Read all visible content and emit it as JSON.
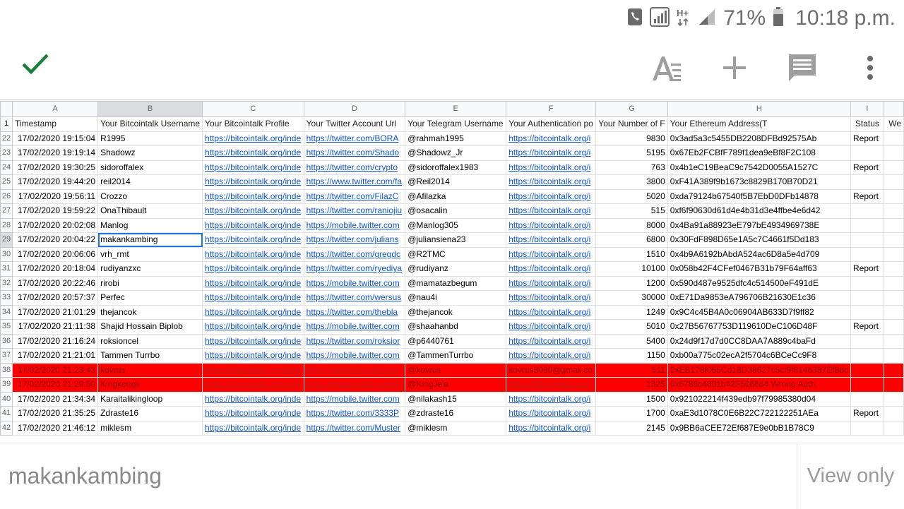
{
  "status_bar": {
    "battery_percent": "71%",
    "time": "10:18 p.m."
  },
  "colors": {
    "accent_check": "#188038",
    "link": "#1155cc",
    "error_row": "#ff0000",
    "selection": "#1a73e8"
  },
  "toolbar": {
    "check_icon": "check-icon",
    "format_icon": "text-format-icon",
    "add_icon": "plus-icon",
    "comment_icon": "comment-icon",
    "more_icon": "more-vertical-icon"
  },
  "columns": [
    "A",
    "B",
    "C",
    "D",
    "E",
    "F",
    "G",
    "H",
    "I"
  ],
  "header_row": {
    "num": "1",
    "cells": [
      "Timestamp",
      "Your Bitcointalk Username",
      "Your Bitcointalk Profile",
      "Your Twitter Account Url",
      "Your Telegram Username",
      "Your Authentication po",
      "Your Number of F",
      "Your Ethereum Address(T",
      "Status",
      "We"
    ]
  },
  "rows": [
    {
      "num": "22",
      "ts": "17/02/2020 19:15:04",
      "user": "R1995",
      "profile": "https://bitcointalk.org/inde",
      "twitter": "https://twitter.com/BORA",
      "tg": "@rahmah1995",
      "auth": "https://bitcointalk.org/i",
      "followers": "9830",
      "eth": "0x3ad5a3c5455DB2208DFBd92575Ab",
      "status": "Report"
    },
    {
      "num": "23",
      "ts": "17/02/2020 19:19:14",
      "user": "Shadowz",
      "profile": "https://bitcointalk.org/inde",
      "twitter": "https://twitter.com/Shado",
      "tg": "@Shadowz_Jr",
      "auth": "https://bitcointalk.org/i",
      "followers": "5195",
      "eth": "0x67Eb2FCBfF789f1dea9eBf8F2C108",
      "status": ""
    },
    {
      "num": "24",
      "ts": "17/02/2020 19:30:25",
      "user": "sidoroffalex",
      "profile": "https://bitcointalk.org/inde",
      "twitter": "https://twitter.com/crypto",
      "tg": "@sidoroffalex1983",
      "auth": "https://bitcointalk.org/i",
      "followers": "763",
      "eth": "0x4b1eC19BeaC9c7542D0055A1527C",
      "status": "Report"
    },
    {
      "num": "25",
      "ts": "17/02/2020 19:44:20",
      "user": "reil2014",
      "profile": "https://bitcointalk.org/inde",
      "twitter": "https://www.twitter.com/fa",
      "tg": "@Reil2014",
      "auth": "https://bitcointalk.org/i",
      "followers": "3800",
      "eth": "0xF41A389f9b1673c8829B170B70D21",
      "status": ""
    },
    {
      "num": "26",
      "ts": "17/02/2020 19:56:11",
      "user": "Crozzo",
      "profile": "https://bitcointalk.org/inde",
      "twitter": "https://twitter.com/FilazC",
      "tg": "@Afilazka",
      "auth": "https://bitcointalk.org/i",
      "followers": "5020",
      "eth": "0xda79124b67540f5B7EbD0DFb14878",
      "status": "Report"
    },
    {
      "num": "27",
      "ts": "17/02/2020 19:59:22",
      "user": "OnaThibault",
      "profile": "https://bitcointalk.org/inde",
      "twitter": "https://twitter.com/raniojiu",
      "tg": "@osacalin",
      "auth": "https://bitcointalk.org/i",
      "followers": "515",
      "eth": "0xf6f90630d61d4e4b31d3e4ffbe4e6d42",
      "status": ""
    },
    {
      "num": "28",
      "ts": "17/02/2020 20:02:08",
      "user": "Manlog",
      "profile": "https://bitcointalk.org/inde",
      "twitter": "https://mobile.twitter.com",
      "tg": "@Manlog305",
      "auth": "https://bitcointalk.org/i",
      "followers": "8000",
      "eth": "0x4Ba91a88923eE797bE4934969738E",
      "status": ""
    },
    {
      "num": "29",
      "ts": "17/02/2020 20:04:22",
      "user": "makankambing",
      "profile": "https://bitcointalk.org/inde",
      "twitter": "https://twitter.com/julians",
      "tg": "@juliansiena23",
      "auth": "https://bitcointalk.org/i",
      "followers": "6800",
      "eth": "0x30FdF898D65e1A5c7C4661f5Dd183",
      "status": ""
    },
    {
      "num": "30",
      "ts": "17/02/2020 20:06:06",
      "user": "vrh_rmt",
      "profile": "https://bitcointalk.org/inde",
      "twitter": "https://twitter.com/gregdc",
      "tg": "@R2TMC",
      "auth": "https://bitcointalk.org/i",
      "followers": "1510",
      "eth": "0x4b9A6192bAbdA524ac6D8a5e4d709",
      "status": ""
    },
    {
      "num": "31",
      "ts": "17/02/2020 20:18:04",
      "user": "rudiyanzxc",
      "profile": "https://bitcointalk.org/inde",
      "twitter": "https://twitter.com/ryediya",
      "tg": "@rudiyanz",
      "auth": "https://bitcointalk.org/i",
      "followers": "10100",
      "eth": "0x058b42F4CFef0467B31b79F64aff63",
      "status": "Report"
    },
    {
      "num": "32",
      "ts": "17/02/2020 20:22:46",
      "user": "rirobi",
      "profile": "https://bitcointalk.org/inde",
      "twitter": "https://mobile.twitter.com",
      "tg": "@mamatazbegum",
      "auth": "https://bitcointalk.org/i",
      "followers": "1200",
      "eth": "0x590d487e9525dfc4c514500eF491dE",
      "status": ""
    },
    {
      "num": "33",
      "ts": "17/02/2020 20:57:37",
      "user": "Perfec",
      "profile": "https://bitcointalk.org/inde",
      "twitter": "https://twitter.com/wersus",
      "tg": "@nau4i",
      "auth": "https://bitcointalk.org/i",
      "followers": "30000",
      "eth": "0xE71Da9853eA796706B21630E1c36",
      "status": ""
    },
    {
      "num": "34",
      "ts": "17/02/2020 21:01:29",
      "user": "thejancok",
      "profile": "https://bitcointalk.org/inde",
      "twitter": "https://twitter.com/thebla",
      "tg": "@thejancok",
      "auth": "https://bitcointalk.org/i",
      "followers": "1249",
      "eth": "0x9C4c45B4A0c06904AB633D7f9ff82",
      "status": ""
    },
    {
      "num": "35",
      "ts": "17/02/2020 21:11:38",
      "user": "Shajid Hossain Biplob",
      "profile": "https://bitcointalk.org/inde",
      "twitter": "https://mobile.twitter.com",
      "tg": "@shaahanbd",
      "auth": "https://bitcointalk.org/i",
      "followers": "5010",
      "eth": "0x27B56767753D119610DeC106D48F",
      "status": "Report"
    },
    {
      "num": "36",
      "ts": "17/02/2020 21:16:24",
      "user": "roksioncel",
      "profile": "https://bitcointalk.org/inde",
      "twitter": "https://twitter.com/roksior",
      "tg": "@p6440761",
      "auth": "https://bitcointalk.org/i",
      "followers": "5400",
      "eth": "0x24d9f17d7d0CC8DAA7A889c4baFd",
      "status": ""
    },
    {
      "num": "37",
      "ts": "17/02/2020 21:21:01",
      "user": "Tammen Turrbo",
      "profile": "https://bitcointalk.org/inde",
      "twitter": "https://mobile.twitter.com",
      "tg": "@TammenTurrbo",
      "auth": "https://bitcointalk.org/i",
      "followers": "1150",
      "eth": "0xb00a775c02ecA2f5704c6BCeCc9F8",
      "status": ""
    },
    {
      "num": "38",
      "red": true,
      "ts": "17/02/2020 21:23:43",
      "user": "kovrus",
      "profile": "https://bitcointalk.org/inde",
      "twitter": "https://twitter.com/kovrus",
      "tg": "@kovrus",
      "auth": "kovrus3080@gmail.co",
      "auth_plain": true,
      "followers": "511",
      "eth": "0xEB178f055Cd18D38627c5cf9f8146387Ef8dc",
      "status": ""
    },
    {
      "num": "39",
      "red": true,
      "ts": "17/02/2020 21:29:50",
      "user": "Kingkongs",
      "profile": "https://bitcointalk.org/inde",
      "twitter": "https://www.twitter.com/Ki",
      "tg": "@KingJela",
      "auth": "https://bitcointalk.org/i",
      "followers": "1325",
      "eth": "0x6788c4801b42F5066d4 Wrong Auth.",
      "status": ""
    },
    {
      "num": "40",
      "ts": "17/02/2020 21:34:34",
      "user": "Karaitalikingloop",
      "profile": "https://bitcointalk.org/inde",
      "twitter": "https://mobile.twitter.com",
      "tg": "@nilakash15",
      "auth": "https://bitcointalk.org/i",
      "followers": "1500",
      "eth": "0x921022214f439edb97f79985380d04",
      "status": ""
    },
    {
      "num": "41",
      "ts": "17/02/2020 21:35:25",
      "user": "Zdraste16",
      "profile": "https://bitcointalk.org/inde",
      "twitter": "https://twitter.com/3333P",
      "tg": "@zdraste16",
      "auth": "https://bitcointalk.org/i",
      "followers": "1700",
      "eth": "0xaE3d1078C0E6B22C722122251AEa",
      "status": "Report"
    },
    {
      "num": "42",
      "ts": "17/02/2020 21:46:12",
      "user": "miklesm",
      "profile": "https://bitcointalk.org/inde",
      "twitter": "https://twitter.com/Muster",
      "tg": "@miklesm",
      "auth": "https://bitcointalk.org/i",
      "followers": "2145",
      "eth": "0x9BB6aCEE72Ef687E9e0bB1B78C9",
      "status": ""
    }
  ],
  "active_cell": {
    "row": "29",
    "col": "B"
  },
  "bottom": {
    "cell_content": "makankambing",
    "mode": "View only"
  }
}
